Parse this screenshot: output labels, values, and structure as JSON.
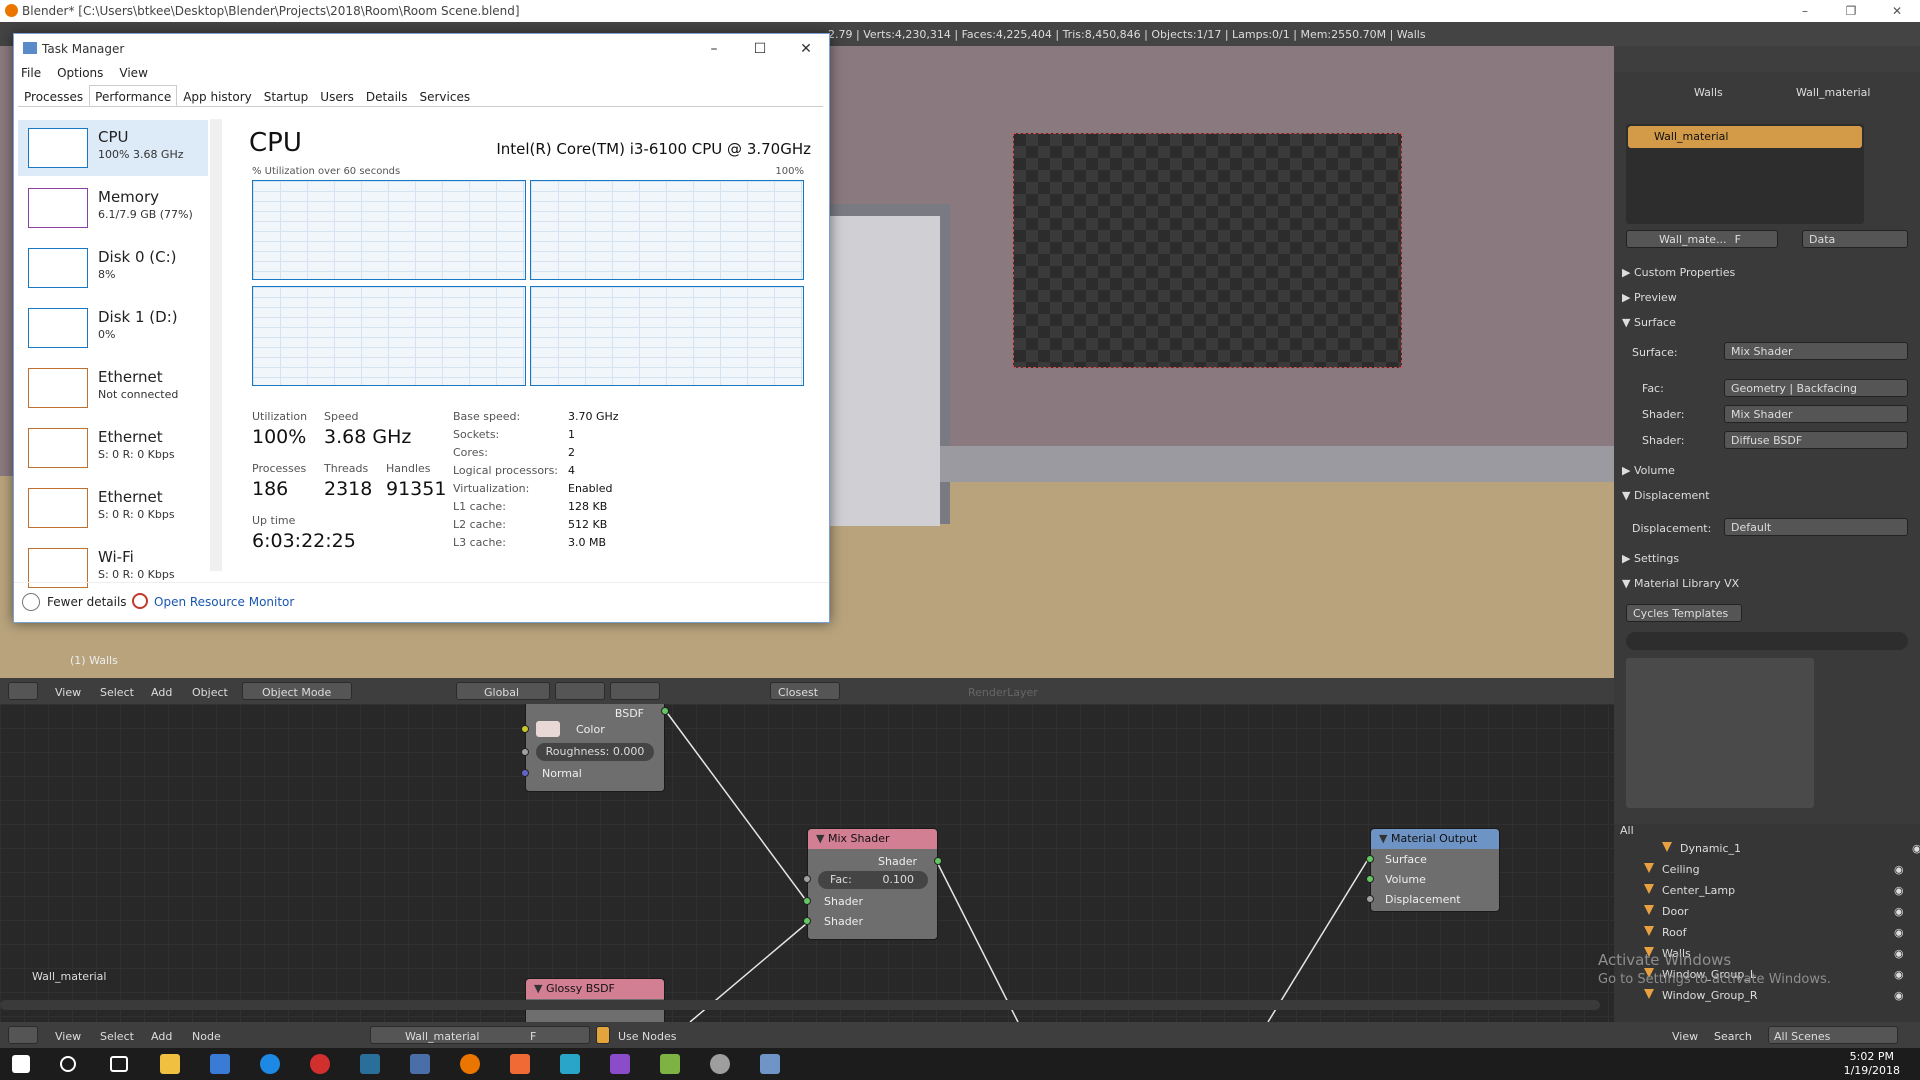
{
  "blender": {
    "title": "Blender* [C:\\Users\\btkee\\Desktop\\Blender\\Projects\\2018\\Room\\Room Scene.blend]",
    "stats": "2.79 | Verts:4,230,314 | Faces:4,225,404 | Tris:8,450,846 | Objects:1/17 | Lamps:0/1 | Mem:2550.70M | Walls",
    "viewport_label": "(1) Walls",
    "viewport_header": {
      "view": "View",
      "select": "Select",
      "add": "Add",
      "object": "Object",
      "mode": "Object Mode",
      "orientation": "Global",
      "snap": "Closest",
      "render_layer": "RenderLayer"
    },
    "node_editor": {
      "material_label": "Wall_material",
      "bsdf_node": {
        "title": "BSDF",
        "color": "Color",
        "roughness": "Roughness: 0.000",
        "normal": "Normal"
      },
      "mix_node": {
        "title": "Mix Shader",
        "out": "Shader",
        "fac_label": "Fac:",
        "fac_value": "0.100",
        "in1": "Shader",
        "in2": "Shader"
      },
      "output_node": {
        "title": "Material Output",
        "surface": "Surface",
        "volume": "Volume",
        "displacement": "Displacement"
      },
      "glossy_node": {
        "title": "Glossy BSDF"
      },
      "header": {
        "view": "View",
        "select": "Select",
        "add": "Add",
        "node": "Node",
        "material": "Wall_material",
        "f": "F",
        "use_nodes": "Use Nodes"
      }
    },
    "properties": {
      "breadcrumb_object": "Walls",
      "breadcrumb_material": "Wall_material",
      "slot": "Wall_material",
      "material_field": "Wall_mate...",
      "f": "F",
      "data": "Data",
      "panels": {
        "custom": "Custom Properties",
        "preview": "Preview",
        "surface": "Surface",
        "volume": "Volume",
        "displacement": "Displacement",
        "settings": "Settings",
        "matlib": "Material Library VX"
      },
      "surface_label": "Surface:",
      "surface_value": "Mix Shader",
      "fac_label": "Fac:",
      "fac_value": "Geometry | Backfacing",
      "shader1_label": "Shader:",
      "shader1_value": "Mix Shader",
      "shader2_label": "Shader:",
      "shader2_value": "Diffuse BSDF",
      "disp_label": "Displacement:",
      "disp_value": "Default",
      "template": "Cycles Templates"
    },
    "outliner": {
      "filter": "All",
      "items": [
        "Dynamic_1",
        "Ceiling",
        "Center_Lamp",
        "Door",
        "Roof",
        "Walls",
        "Window_Group_L",
        "Window_Group_R"
      ],
      "header": {
        "view": "View",
        "search": "Search",
        "scenes": "All Scenes"
      }
    }
  },
  "watermark": {
    "line1": "Activate Windows",
    "line2": "Go to Settings to activate Windows."
  },
  "taskbar": {
    "time": "5:02 PM",
    "date": "1/19/2018"
  },
  "task_manager": {
    "title": "Task Manager",
    "menu": [
      "File",
      "Options",
      "View"
    ],
    "tabs": [
      "Processes",
      "Performance",
      "App history",
      "Startup",
      "Users",
      "Details",
      "Services"
    ],
    "sidebar": [
      {
        "name": "CPU",
        "sub": "100% 3.68 GHz"
      },
      {
        "name": "Memory",
        "sub": "6.1/7.9 GB (77%)"
      },
      {
        "name": "Disk 0 (C:)",
        "sub": "8%"
      },
      {
        "name": "Disk 1 (D:)",
        "sub": "0%"
      },
      {
        "name": "Ethernet",
        "sub": "Not connected"
      },
      {
        "name": "Ethernet",
        "sub": "S: 0 R: 0 Kbps"
      },
      {
        "name": "Ethernet",
        "sub": "S: 0 R: 0 Kbps"
      },
      {
        "name": "Wi-Fi",
        "sub": "S: 0 R: 0 Kbps"
      }
    ],
    "cpu": {
      "title": "CPU",
      "model": "Intel(R) Core(TM) i3-6100 CPU @ 3.70GHz",
      "graph_label": "% Utilization over 60 seconds",
      "graph_max": "100%",
      "utilization_label": "Utilization",
      "utilization": "100%",
      "speed_label": "Speed",
      "speed": "3.68 GHz",
      "processes_label": "Processes",
      "processes": "186",
      "threads_label": "Threads",
      "threads": "2318",
      "handles_label": "Handles",
      "handles": "91351",
      "uptime_label": "Up time",
      "uptime": "6:03:22:25",
      "specs": [
        {
          "label": "Base speed:",
          "value": "3.70 GHz"
        },
        {
          "label": "Sockets:",
          "value": "1"
        },
        {
          "label": "Cores:",
          "value": "2"
        },
        {
          "label": "Logical processors:",
          "value": "4"
        },
        {
          "label": "Virtualization:",
          "value": "Enabled"
        },
        {
          "label": "L1 cache:",
          "value": "128 KB"
        },
        {
          "label": "L2 cache:",
          "value": "512 KB"
        },
        {
          "label": "L3 cache:",
          "value": "3.0 MB"
        }
      ]
    },
    "footer": {
      "fewer": "Fewer details",
      "resmon": "Open Resource Monitor"
    }
  }
}
